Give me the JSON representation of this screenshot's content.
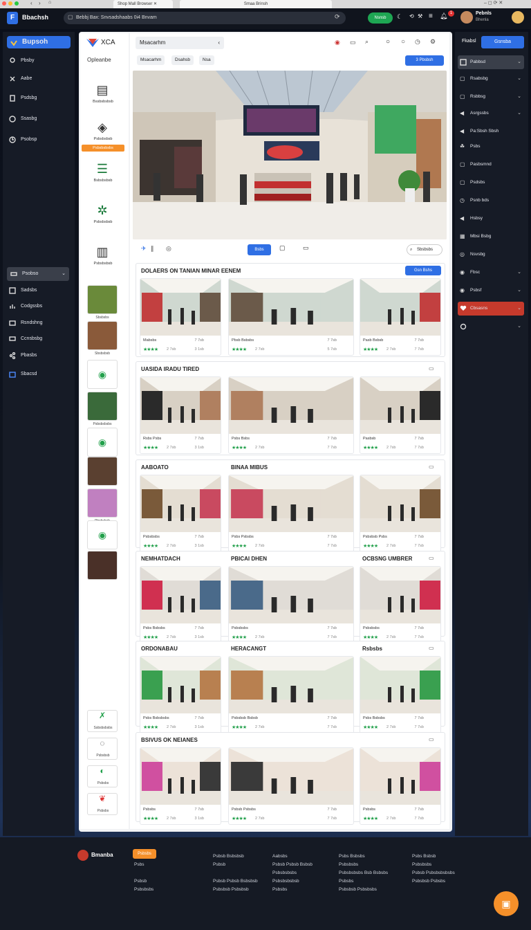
{
  "browser": {
    "tabs": [
      "Shop Mall Browser",
      "Smaa Brinsh"
    ],
    "address": "Bebbj Bax: Snvsadshaabs 0i4 Bnvam"
  },
  "app": {
    "brand": "Bbachsh",
    "green_button": "Nsnsb",
    "user_name": "Pebnls",
    "user_sub": "Bhenla",
    "notif_count": "1"
  },
  "left_nav": {
    "brand": "Bupsoh",
    "items": [
      "Pbsby",
      "Aabe",
      "Psdsbg",
      "Ssasbg",
      "Psobsp"
    ],
    "dropdown": "Psobso",
    "items2": [
      "Sadsbs",
      "Codgssbs",
      "Rsndshng",
      "Ccnsbsbg",
      "Pbasbs",
      "Sbacsd"
    ]
  },
  "right_nav": {
    "header": "Fkabsl",
    "button": "Gsnsba",
    "dropdown": "Pabbsd",
    "items": [
      "Rsabsbg",
      "Rsbbsg",
      "Asrgssbs",
      "Pa:Sbsh Sbsh",
      "Psbs",
      "Pasbsmnd",
      "Psdsbs",
      "Psnb bds",
      "Hsbsy",
      "Mbsi Bsbg",
      "Nsvsbg",
      "Fbsc",
      "Psbsf"
    ],
    "red_item": "Cbsasns"
  },
  "panel": {
    "logo": "XCA",
    "subtitle": "Opleanbe",
    "search_value": "Msacarhm",
    "filter_pills": [
      "Msacarhm",
      "Dsahsb",
      "Nsa"
    ],
    "blue_pill": "3 Pbsbsh",
    "hero_tab": "Bsbs",
    "hero_search": "Sbsbsbs"
  },
  "left_col": {
    "icons": [
      {
        "icon": "store-icon",
        "caption": "Bssbsbsbsb"
      },
      {
        "icon": "bag-icon",
        "caption": "Psbsbsbsb"
      },
      {
        "icon": "list-icon",
        "caption": "Bsbsbsbsb"
      },
      {
        "icon": "leaf-icon",
        "caption": "Psbsbsbsb"
      },
      {
        "icon": "shop-icon",
        "caption": "Psbsbsbsb"
      }
    ],
    "orange_label": "Psbsbsbsbs",
    "thumb_captions": [
      "Sbsbsbs",
      "Sbsbsbsb",
      "",
      "Psbsbsbsbs",
      "",
      "",
      "Pbsbsbsb",
      "",
      ""
    ],
    "bottom": [
      "Ssbsbsbsbs",
      "Psbsbsb",
      "Psbsbs",
      "Psbsbs"
    ]
  },
  "sections": [
    {
      "title": "DOLAERS ON TANIAN MINAR EENEM",
      "action": "Gsn Bshs",
      "cards": [
        [
          "Mabsbs",
          "7 7sb",
          "2 7sb",
          "3 1sb"
        ],
        [
          "Pbsb Bsbsbs",
          "7 7sb",
          "2 7sb",
          "5 7sb"
        ],
        [
          "Pasb Bsbsb",
          "7 7sb",
          "2 7sb",
          "7 7sb"
        ]
      ]
    },
    {
      "title": "UASIDA IRADU TIRED",
      "action": "",
      "cards": [
        [
          "Rsbs Psbs",
          "7 7sb",
          "2 7sb",
          "3 1sb"
        ],
        [
          "Psbs Bsbs",
          "7 7sb",
          "2 7sb",
          "7 7sb"
        ],
        [
          "Pasbsb",
          "7 7sb",
          "2 7sb",
          "7 7sb"
        ]
      ]
    },
    {
      "title": "AABOATO",
      "title2": "BINAA MIBUS",
      "action": "",
      "cards": [
        [
          "Psbsbsbs",
          "7 7sb",
          "2 7sb",
          "3 1sb"
        ],
        [
          "Psbs Psbsbs",
          "7 7sb",
          "2 7sb",
          "7 7sb"
        ],
        [
          "Psbsbsb Psbs",
          "7 7sb",
          "2 7sb",
          "7 7sb"
        ]
      ]
    },
    {
      "title": "NEMHATDACH",
      "title2": "PBICAI DHEN",
      "title3": "OCBSNG UMBRER",
      "action": "",
      "cards": [
        [
          "Psbs Bsbsbs",
          "7 7sb",
          "2 7sb",
          "3 1sb"
        ],
        [
          "Psbsbsbs",
          "7 7sb",
          "2 7sb",
          "7 7sb"
        ],
        [
          "Psbsbsbs",
          "7 7sb",
          "2 7sb",
          "7 7sb"
        ]
      ]
    },
    {
      "title": "ORDONABAU",
      "title2": "HERACANGT",
      "title3": "Rsbsbs",
      "action": "",
      "cards": [
        [
          "Psbs Bsbsbsbs",
          "7 7sb",
          "2 7sb",
          "3 1sb"
        ],
        [
          "Psbsbsb Bsbsb",
          "7 7sb",
          "2 7sb",
          "7 7sb"
        ],
        [
          "Psbs Bsbsbs",
          "7 7sb",
          "2 7sb",
          "7 7sb"
        ]
      ]
    },
    {
      "title": "BSIVUS OK NEIANES",
      "action": "",
      "cards": [
        [
          "Psbsbs",
          "7 7sb",
          "2 7sb",
          "3 1sb"
        ],
        [
          "Psbsb Psbsbs",
          "7 7sb",
          "2 7sb",
          "7 7sb"
        ],
        [
          "Psbsbs",
          "7 7sb",
          "2 7sb",
          "7 7sb"
        ]
      ]
    }
  ],
  "footer": {
    "brand": "Bmanba",
    "orange_tag": "Psbsbs",
    "col0": [
      "Psbs",
      "",
      "Psbsb",
      "Psbsbsbs"
    ],
    "col1": [
      "Psbsb Bsbsbsb",
      "Psbsb",
      "",
      "Psbsb Psbsb Bsbsbsb",
      "Psbsbsb Psbsbsb"
    ],
    "col2": [
      "Aabsbs",
      "Psbsb Psbsb Bsbsb",
      "Psbsbsbsbs",
      "Psbsbsbsbsb",
      "Psbsbs"
    ],
    "col3": [
      "Psbs Bsbsbs",
      "Psbsbsbs",
      "Psbsbsbsbs Bsb Bsbsbs",
      "Psbsbs",
      "Psbsbsb Psbsbsbs"
    ],
    "col4": [
      "Psbs Bsbsb",
      "Psbsbsbs",
      "Psbsb Psbsbsbsbsbs",
      "Psbsbsb Psbsbs"
    ]
  },
  "colors": {
    "accent": "#2f6fe4",
    "green": "#1ea653",
    "orange": "#f5902a",
    "red": "#c63a2c",
    "star": "#22a04b"
  }
}
